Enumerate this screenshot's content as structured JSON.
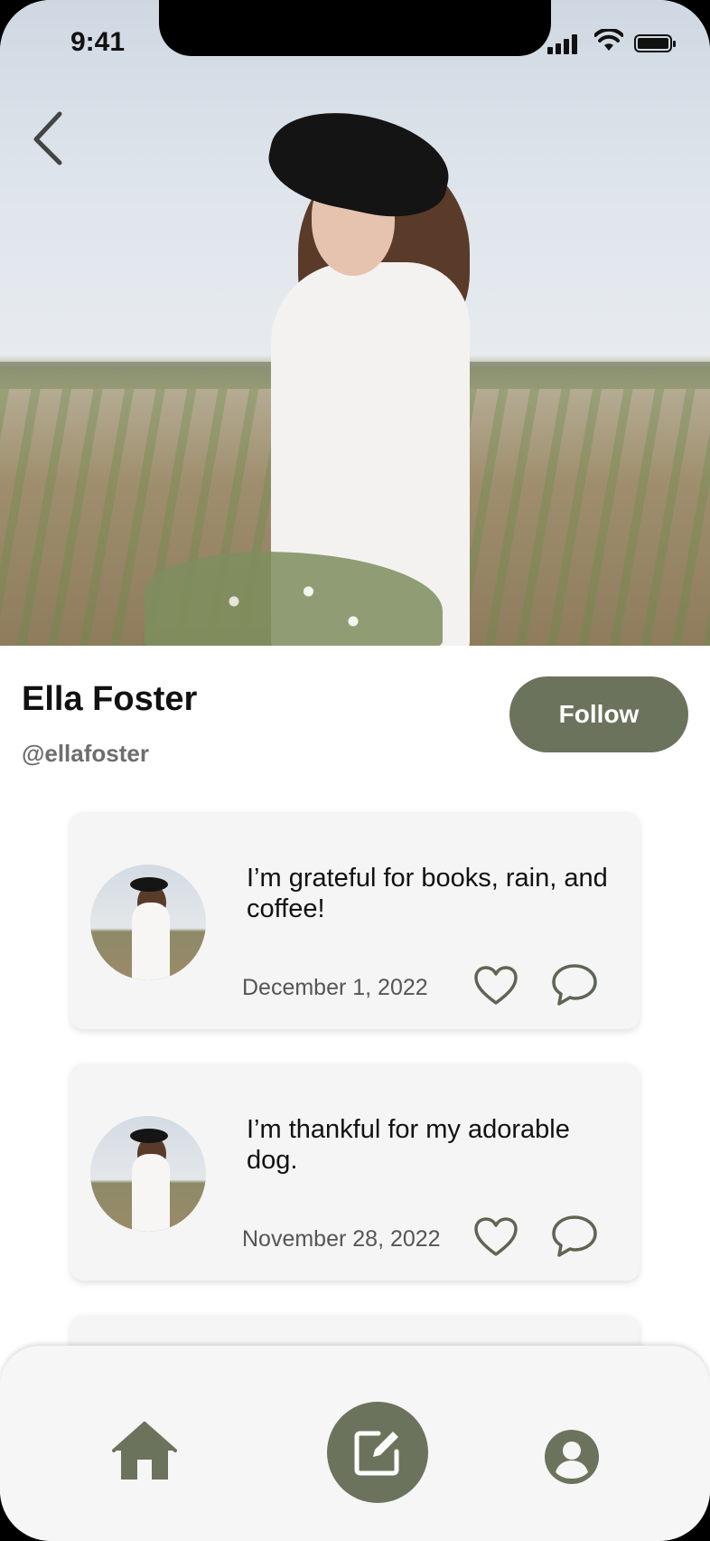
{
  "status_bar": {
    "time": "9:41",
    "icons": [
      "signal-icon",
      "wifi-icon",
      "battery-icon"
    ]
  },
  "header": {
    "back_icon": "chevron-left-icon"
  },
  "profile": {
    "name": "Ella Foster",
    "handle": "@ellafoster",
    "follow_label": "Follow"
  },
  "posts": [
    {
      "text": "I’m grateful for books, rain, and coffee!",
      "date": "December 1, 2022",
      "icons": [
        "heart-icon",
        "comment-icon"
      ]
    },
    {
      "text": "I’m thankful for my adorable dog.",
      "date": "November 28, 2022",
      "icons": [
        "heart-icon",
        "comment-icon"
      ]
    }
  ],
  "bottom_nav": {
    "items": [
      "home-icon",
      "compose-icon",
      "profile-icon"
    ]
  },
  "colors": {
    "accent": "#6b735c",
    "card_bg": "#f5f5f5",
    "nav_bg": "#f6f6f6",
    "text_primary": "#111111",
    "text_secondary": "#6e6e6e"
  }
}
